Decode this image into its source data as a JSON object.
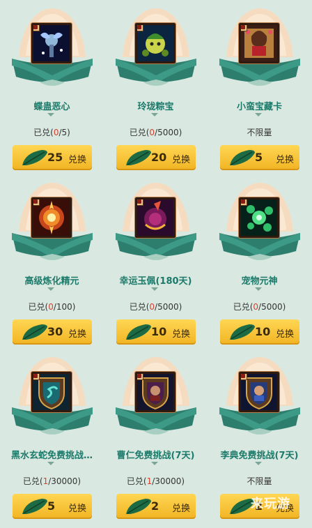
{
  "items": [
    {
      "name": "蝶蛊恶心",
      "count_prefix": "已兑(",
      "count_used": "0",
      "count_suffix": "/5)",
      "cost": "25",
      "btn_label": "兑换",
      "icon": "butterfly-gu-icon"
    },
    {
      "name": "玲珑粽宝",
      "count_prefix": "已兑(",
      "count_used": "0",
      "count_suffix": "/5000)",
      "cost": "20",
      "btn_label": "兑换",
      "icon": "zongzi-pet-icon"
    },
    {
      "name": "小蛮宝藏卡",
      "count_prefix": "不限量",
      "count_used": "",
      "count_suffix": "",
      "cost": "5",
      "btn_label": "兑换",
      "icon": "treasure-card-icon"
    },
    {
      "name": "高级炼化精元",
      "count_prefix": "已兑(",
      "count_used": "0",
      "count_suffix": "/100)",
      "cost": "30",
      "btn_label": "兑换",
      "icon": "refine-essence-icon"
    },
    {
      "name": "幸运玉佩(180天)",
      "count_prefix": "已兑(",
      "count_used": "0",
      "count_suffix": "/5000)",
      "cost": "10",
      "btn_label": "兑换",
      "icon": "jade-pendant-icon"
    },
    {
      "name": "宠物元神",
      "count_prefix": "已兑(",
      "count_used": "0",
      "count_suffix": "/5000)",
      "cost": "10",
      "btn_label": "兑换",
      "icon": "pet-spirit-icon"
    },
    {
      "name": "黑水玄蛇免费挑战…",
      "count_prefix": "已兑(",
      "count_used": "1",
      "count_suffix": "/30000)",
      "cost": "5",
      "btn_label": "兑换",
      "icon": "black-serpent-shield-icon"
    },
    {
      "name": "曹仁免费挑战(7天)",
      "count_prefix": "已兑(",
      "count_used": "1",
      "count_suffix": "/30000)",
      "cost": "2",
      "btn_label": "兑换",
      "icon": "cao-ren-shield-icon"
    },
    {
      "name": "李典免费挑战(7天)",
      "count_prefix": "不限量",
      "count_used": "",
      "count_suffix": "",
      "cost": "2",
      "btn_label": "兑换",
      "icon": "li-dian-shield-icon"
    }
  ],
  "colors": {
    "background": "#d9e9e1",
    "dumpling_top": "#f5dcc0",
    "dumpling_leaf": "#2e7e6e",
    "name_text": "#1c7a6a",
    "highlight": "#d8402f",
    "button": "#f1b423"
  },
  "watermark": "来玩游"
}
